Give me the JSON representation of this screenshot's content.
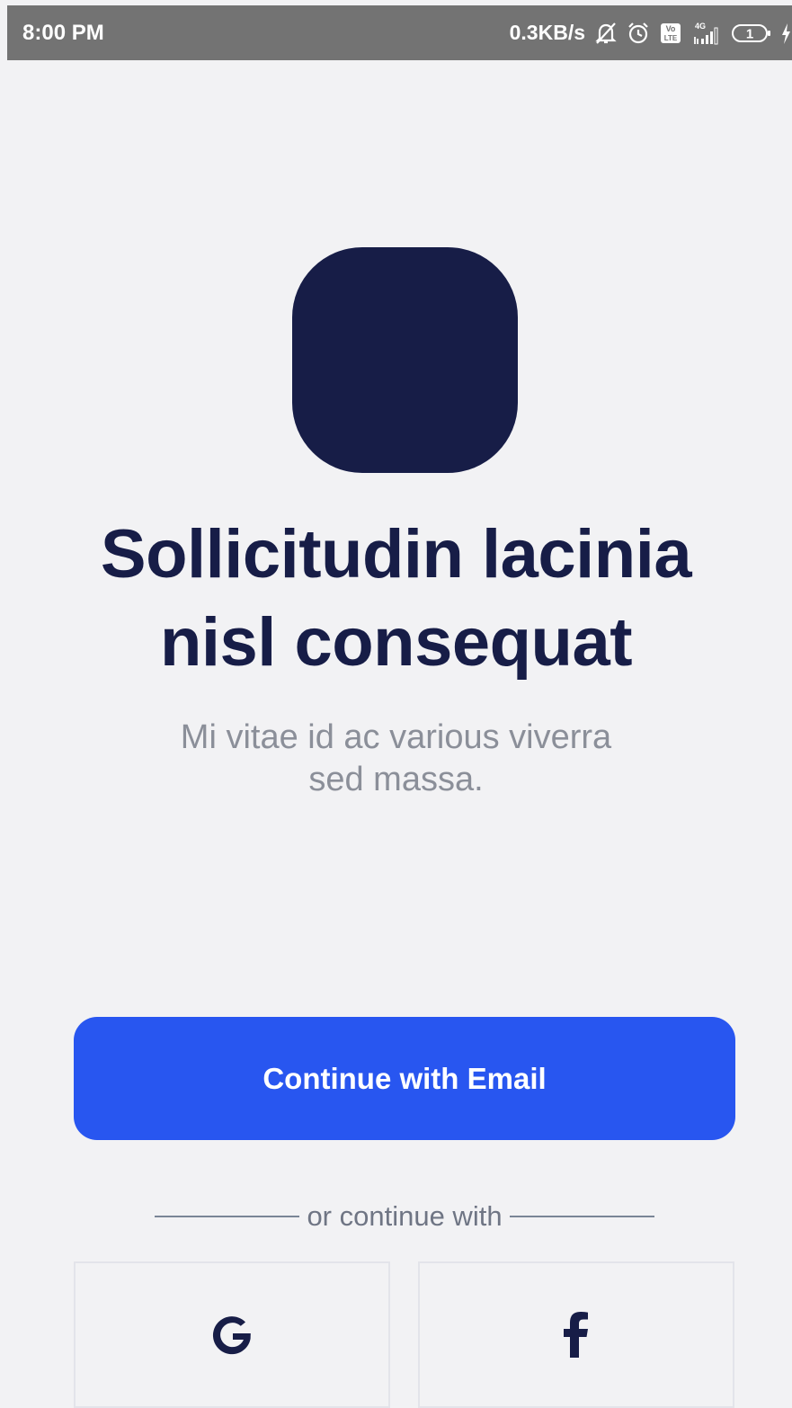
{
  "status_bar": {
    "time": "8:00 PM",
    "net_speed": "0.3KB/s",
    "signal_type": "4G",
    "battery_level": "1",
    "icons": [
      "mute-icon",
      "alarm-icon",
      "volte-icon",
      "signal-icon",
      "battery-icon",
      "charging-icon"
    ]
  },
  "app": {
    "logo": "app-logo",
    "headline_line1": "Sollicitudin lacinia",
    "headline_line2": "nisl consequat",
    "subtitle_line1": "Mi vitae id ac various viverra",
    "subtitle_line2": "sed massa."
  },
  "actions": {
    "email_button_label": "Continue with Email",
    "divider_text": "or continue with",
    "social": [
      {
        "name": "google",
        "icon": "google-icon"
      },
      {
        "name": "facebook",
        "icon": "facebook-icon"
      }
    ]
  },
  "colors": {
    "navy": "#171d47",
    "primary_blue": "#2856f0",
    "background": "#f2f2f4",
    "subtitle_gray": "#8b8f99",
    "status_bar": "#737373"
  }
}
